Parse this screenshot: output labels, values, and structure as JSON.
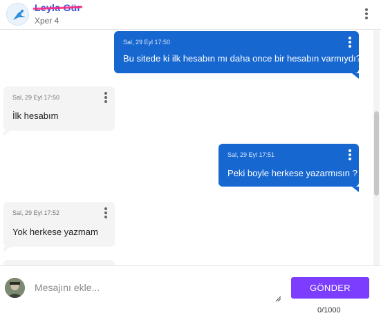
{
  "header": {
    "name": "Leyla Gür",
    "subtitle": "Xper 4"
  },
  "messages": [
    {
      "direction": "out",
      "time": "Sal, 29 Eyl 17:50",
      "text": "Bu sitede ki ilk hesabın mı daha once bir hesabın varmıydı?"
    },
    {
      "direction": "in",
      "time": "Sal, 29 Eyl 17:50",
      "text": "İlk hesabım"
    },
    {
      "direction": "out",
      "time": "Sal, 29 Eyl 17:51",
      "text": "Peki boyle herkese yazarmısın ?"
    },
    {
      "direction": "in",
      "time": "Sal, 29 Eyl 17:52",
      "text": "Yok herkese yazmam"
    }
  ],
  "composer": {
    "placeholder": "Mesajını ekle...",
    "value": "",
    "send_label": "GÖNDER",
    "counter": "0/1000"
  },
  "colors": {
    "outgoing_bubble": "#1767d1",
    "incoming_bubble": "#f4f4f4",
    "send_button": "#7c3dff",
    "name_accent": "#3a56d9"
  },
  "icons": {
    "header_menu": "kebab-menu-icon",
    "message_menu": "kebab-menu-icon",
    "contact_avatar": "avatar-icon",
    "user_avatar": "avatar-icon"
  }
}
